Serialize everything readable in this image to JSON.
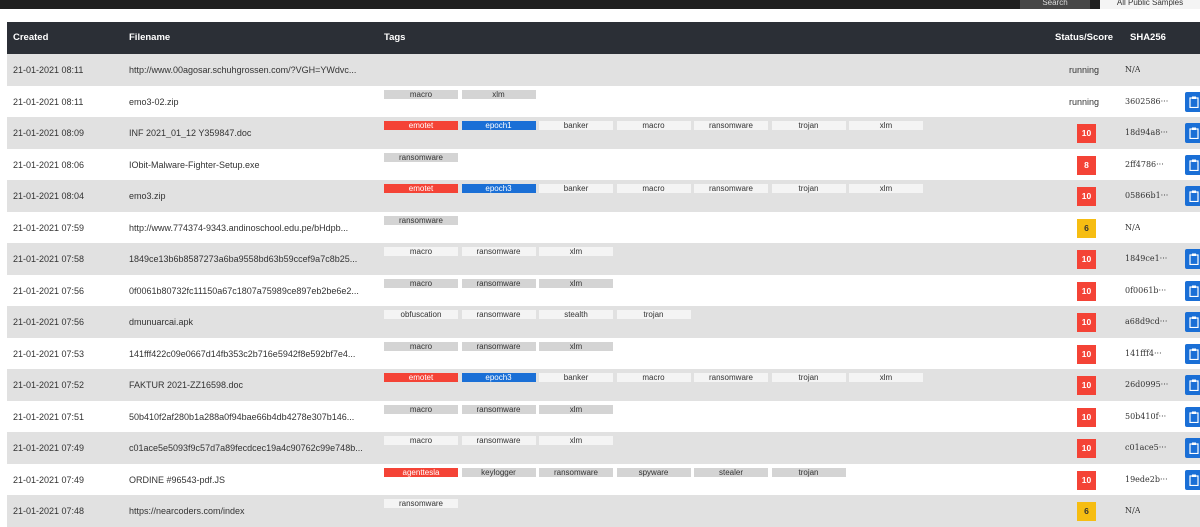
{
  "topbar": {
    "search_label": "Search",
    "public_label": "All Public Samples"
  },
  "columns": {
    "created": "Created",
    "filename": "Filename",
    "tags": "Tags",
    "status": "Status/Score",
    "sha": "SHA256"
  },
  "colors": {
    "header": "#2b2f36",
    "score_high": "#f44336",
    "score_mid": "#f6bd12",
    "tag_emotet": "#f44336",
    "tag_epoch": "#1a6fd6",
    "copy": "#1a6fd6"
  },
  "rows": [
    {
      "created": "21-01-2021 08:11",
      "filename": "http://www.00agosar.schuhgrossen.com/?VGH=YWdvc...",
      "tags": [],
      "status": "running",
      "score": "",
      "sha": "N/A",
      "copy": false
    },
    {
      "created": "21-01-2021 08:11",
      "filename": "emo3-02.zip",
      "tags": [
        "macro",
        "xlm"
      ],
      "status": "running",
      "score": "",
      "sha": "3602586···",
      "copy": true
    },
    {
      "created": "21-01-2021 08:09",
      "filename": "INF 2021_01_12 Y359847.doc",
      "tags": [
        "emotet",
        "epoch1",
        "banker",
        "macro",
        "ransomware",
        "trojan",
        "xlm"
      ],
      "status": "",
      "score": "10",
      "sha": "18d94a8···",
      "copy": true
    },
    {
      "created": "21-01-2021 08:06",
      "filename": "IObit-Malware-Fighter-Setup.exe",
      "tags": [
        "ransomware"
      ],
      "status": "",
      "score": "8",
      "sha": "2ff4786···",
      "copy": true
    },
    {
      "created": "21-01-2021 08:04",
      "filename": "emo3.zip",
      "tags": [
        "emotet",
        "epoch3",
        "banker",
        "macro",
        "ransomware",
        "trojan",
        "xlm"
      ],
      "status": "",
      "score": "10",
      "sha": "05866b1···",
      "copy": true
    },
    {
      "created": "21-01-2021 07:59",
      "filename": "http://www.774374-9343.andinoschool.edu.pe/bHdpb...",
      "tags": [
        "ransomware"
      ],
      "status": "",
      "score": "6",
      "sha": "N/A",
      "copy": false
    },
    {
      "created": "21-01-2021 07:58",
      "filename": "1849ce13b6b8587273a6ba9558bd63b59ccef9a7c8b25...",
      "tags": [
        "macro",
        "ransomware",
        "xlm"
      ],
      "status": "",
      "score": "10",
      "sha": "1849ce1···",
      "copy": true
    },
    {
      "created": "21-01-2021 07:56",
      "filename": "0f0061b80732fc11150a67c1807a75989ce897eb2be6e2...",
      "tags": [
        "macro",
        "ransomware",
        "xlm"
      ],
      "status": "",
      "score": "10",
      "sha": "0f0061b···",
      "copy": true
    },
    {
      "created": "21-01-2021 07:56",
      "filename": "dmunuarcai.apk",
      "tags": [
        "obfuscation",
        "ransomware",
        "stealth",
        "trojan"
      ],
      "status": "",
      "score": "10",
      "sha": "a68d9cd···",
      "copy": true
    },
    {
      "created": "21-01-2021 07:53",
      "filename": "141fff422c09e0667d14fb353c2b716e5942f8e592bf7e4...",
      "tags": [
        "macro",
        "ransomware",
        "xlm"
      ],
      "status": "",
      "score": "10",
      "sha": "141fff4···",
      "copy": true
    },
    {
      "created": "21-01-2021 07:52",
      "filename": "FAKTUR 2021-ZZ16598.doc",
      "tags": [
        "emotet",
        "epoch3",
        "banker",
        "macro",
        "ransomware",
        "trojan",
        "xlm"
      ],
      "status": "",
      "score": "10",
      "sha": "26d0995···",
      "copy": true
    },
    {
      "created": "21-01-2021 07:51",
      "filename": "50b410f2af280b1a288a0f94bae66b4db4278e307b146...",
      "tags": [
        "macro",
        "ransomware",
        "xlm"
      ],
      "status": "",
      "score": "10",
      "sha": "50b410f···",
      "copy": true
    },
    {
      "created": "21-01-2021 07:49",
      "filename": "c01ace5e5093f9c57d7a89fecdcec19a4c90762c99e748b...",
      "tags": [
        "macro",
        "ransomware",
        "xlm"
      ],
      "status": "",
      "score": "10",
      "sha": "c01ace5···",
      "copy": true
    },
    {
      "created": "21-01-2021 07:49",
      "filename": "ORDINE #96543-pdf.JS",
      "tags": [
        "agenttesla",
        "keylogger",
        "ransomware",
        "spyware",
        "stealer",
        "trojan"
      ],
      "status": "",
      "score": "10",
      "sha": "19ede2b···",
      "copy": true
    },
    {
      "created": "21-01-2021 07:48",
      "filename": "https://nearcoders.com/index",
      "tags": [
        "ransomware"
      ],
      "status": "",
      "score": "6",
      "sha": "N/A",
      "copy": false
    }
  ]
}
